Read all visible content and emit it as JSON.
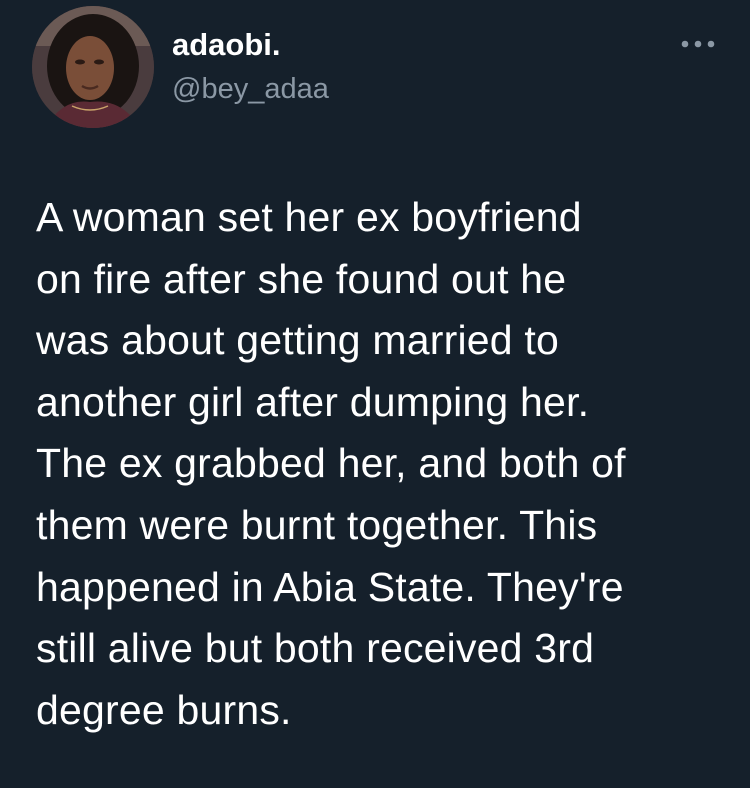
{
  "author": {
    "display_name": "adaobi.",
    "handle": "@bey_adaa",
    "avatar_icon": "profile-photo"
  },
  "menu": {
    "icon": "more-horizontal-icon"
  },
  "tweet": {
    "text": "A woman set her ex boyfriend\non fire after she found out he\nwas about getting married to\nanother girl after dumping her.\nThe ex grabbed her, and both of\nthem were burnt together. This\nhappened in Abia State. They're\nstill alive but both received 3rd\ndegree burns."
  },
  "colors": {
    "background": "#15202b",
    "primary_text": "#ffffff",
    "secondary_text": "#8b98a5"
  }
}
